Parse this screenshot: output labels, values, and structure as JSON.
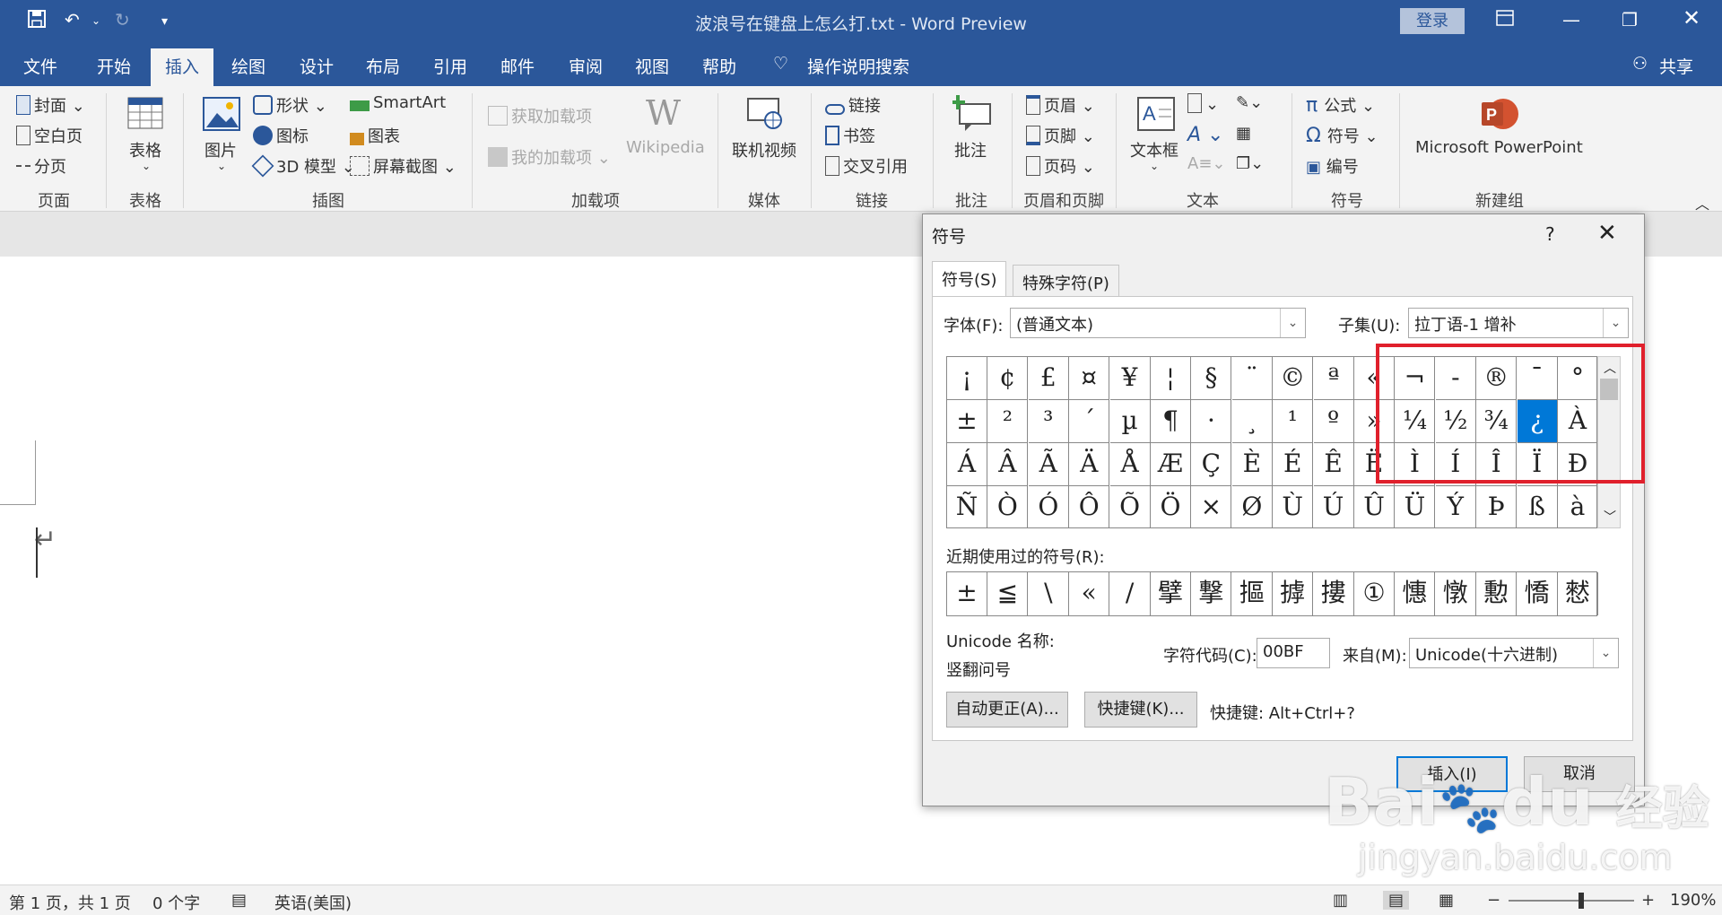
{
  "titlebar": {
    "title": "波浪号在键盘上怎么打.txt  -  Word Preview",
    "login": "登录"
  },
  "menu": [
    "文件",
    "开始",
    "插入",
    "绘图",
    "设计",
    "布局",
    "引用",
    "邮件",
    "审阅",
    "视图",
    "帮助"
  ],
  "menu_active": "插入",
  "tell_me": "操作说明搜索",
  "share": "共享",
  "ribbon": {
    "page_group": {
      "items": [
        "封面",
        "空白页",
        "分页"
      ],
      "label": "页面"
    },
    "table_group": {
      "item": "表格",
      "label": "表格"
    },
    "illus_group": {
      "picture": "图片",
      "shapes": "形状",
      "icons": "图标",
      "model3d": "3D 模型",
      "smartart": "SmartArt",
      "chart": "图表",
      "screenshot": "屏幕截图",
      "label": "插图"
    },
    "addin_group": {
      "get": "获取加载项",
      "mine": "我的加载项",
      "wiki": "Wikipedia",
      "label": "加载项"
    },
    "media_group": {
      "video": "联机视频",
      "label": "媒体"
    },
    "link_group": {
      "link": "链接",
      "bookmark": "书签",
      "xref": "交叉引用",
      "label": "链接"
    },
    "comment_group": {
      "comment": "批注",
      "label": "批注"
    },
    "hf_group": {
      "header": "页眉",
      "footer": "页脚",
      "pagenum": "页码",
      "label": "页眉和页脚"
    },
    "text_group": {
      "textbox": "文本框",
      "label": "文本"
    },
    "symbol_group": {
      "equation": "公式",
      "symbol": "符号",
      "number": "编号",
      "label": "符号"
    },
    "new_group": {
      "ppt": "Microsoft PowerPoint",
      "label": "新建组"
    }
  },
  "dialog": {
    "title": "符号",
    "help": "?",
    "tabs": [
      "符号(S)",
      "特殊字符(P)"
    ],
    "font_label": "字体(F):",
    "font_value": "(普通文本)",
    "subset_label": "子集(U):",
    "subset_value": "拉丁语-1 增补",
    "rows": [
      [
        "¡",
        "¢",
        "£",
        "¤",
        "¥",
        "¦",
        "§",
        "¨",
        "©",
        "ª",
        "«",
        "¬",
        "-",
        "®",
        "¯",
        "°"
      ],
      [
        "±",
        "²",
        "³",
        "´",
        "µ",
        "¶",
        "·",
        "¸",
        "¹",
        "º",
        "»",
        "¼",
        "½",
        "¾",
        "¿",
        "À"
      ],
      [
        "Á",
        "Â",
        "Ã",
        "Ä",
        "Å",
        "Æ",
        "Ç",
        "È",
        "É",
        "Ê",
        "Ë",
        "Ì",
        "Í",
        "Î",
        "Ï",
        "Ð"
      ],
      [
        "Ñ",
        "Ò",
        "Ó",
        "Ô",
        "Õ",
        "Ö",
        "×",
        "Ø",
        "Ù",
        "Ú",
        "Û",
        "Ü",
        "Ý",
        "Þ",
        "ß",
        "à"
      ]
    ],
    "selected": "¿",
    "recent_label": "近期使用过的符号(R):",
    "recent": [
      "±",
      "≦",
      "\\",
      "«",
      "/",
      "擘",
      "撃",
      "摳",
      "摢",
      "摟",
      "①",
      "憓",
      "憞",
      "憅",
      "憍",
      "憖"
    ],
    "unicode_name_label": "Unicode 名称:",
    "unicode_name": "竖翻问号",
    "code_label": "字符代码(C):",
    "code_value": "00BF",
    "from_label": "来自(M):",
    "from_value": "Unicode(十六进制)",
    "autocorrect": "自动更正(A)...",
    "shortcut_btn": "快捷键(K)...",
    "shortcut_text": "快捷键: Alt+Ctrl+?",
    "insert": "插入(I)",
    "cancel": "取消"
  },
  "status": {
    "page": "第 1 页，共 1 页",
    "words": "0 个字",
    "lang": "英语(美国)",
    "zoom": "190%"
  },
  "watermark": {
    "brand": "Bai",
    "brand2": "du",
    "jingyan": "经验",
    "url": "jingyan.baidu.com"
  },
  "colors": {
    "accent": "#2b579a",
    "selection": "#0078d7",
    "highlight": "#e0202c"
  }
}
